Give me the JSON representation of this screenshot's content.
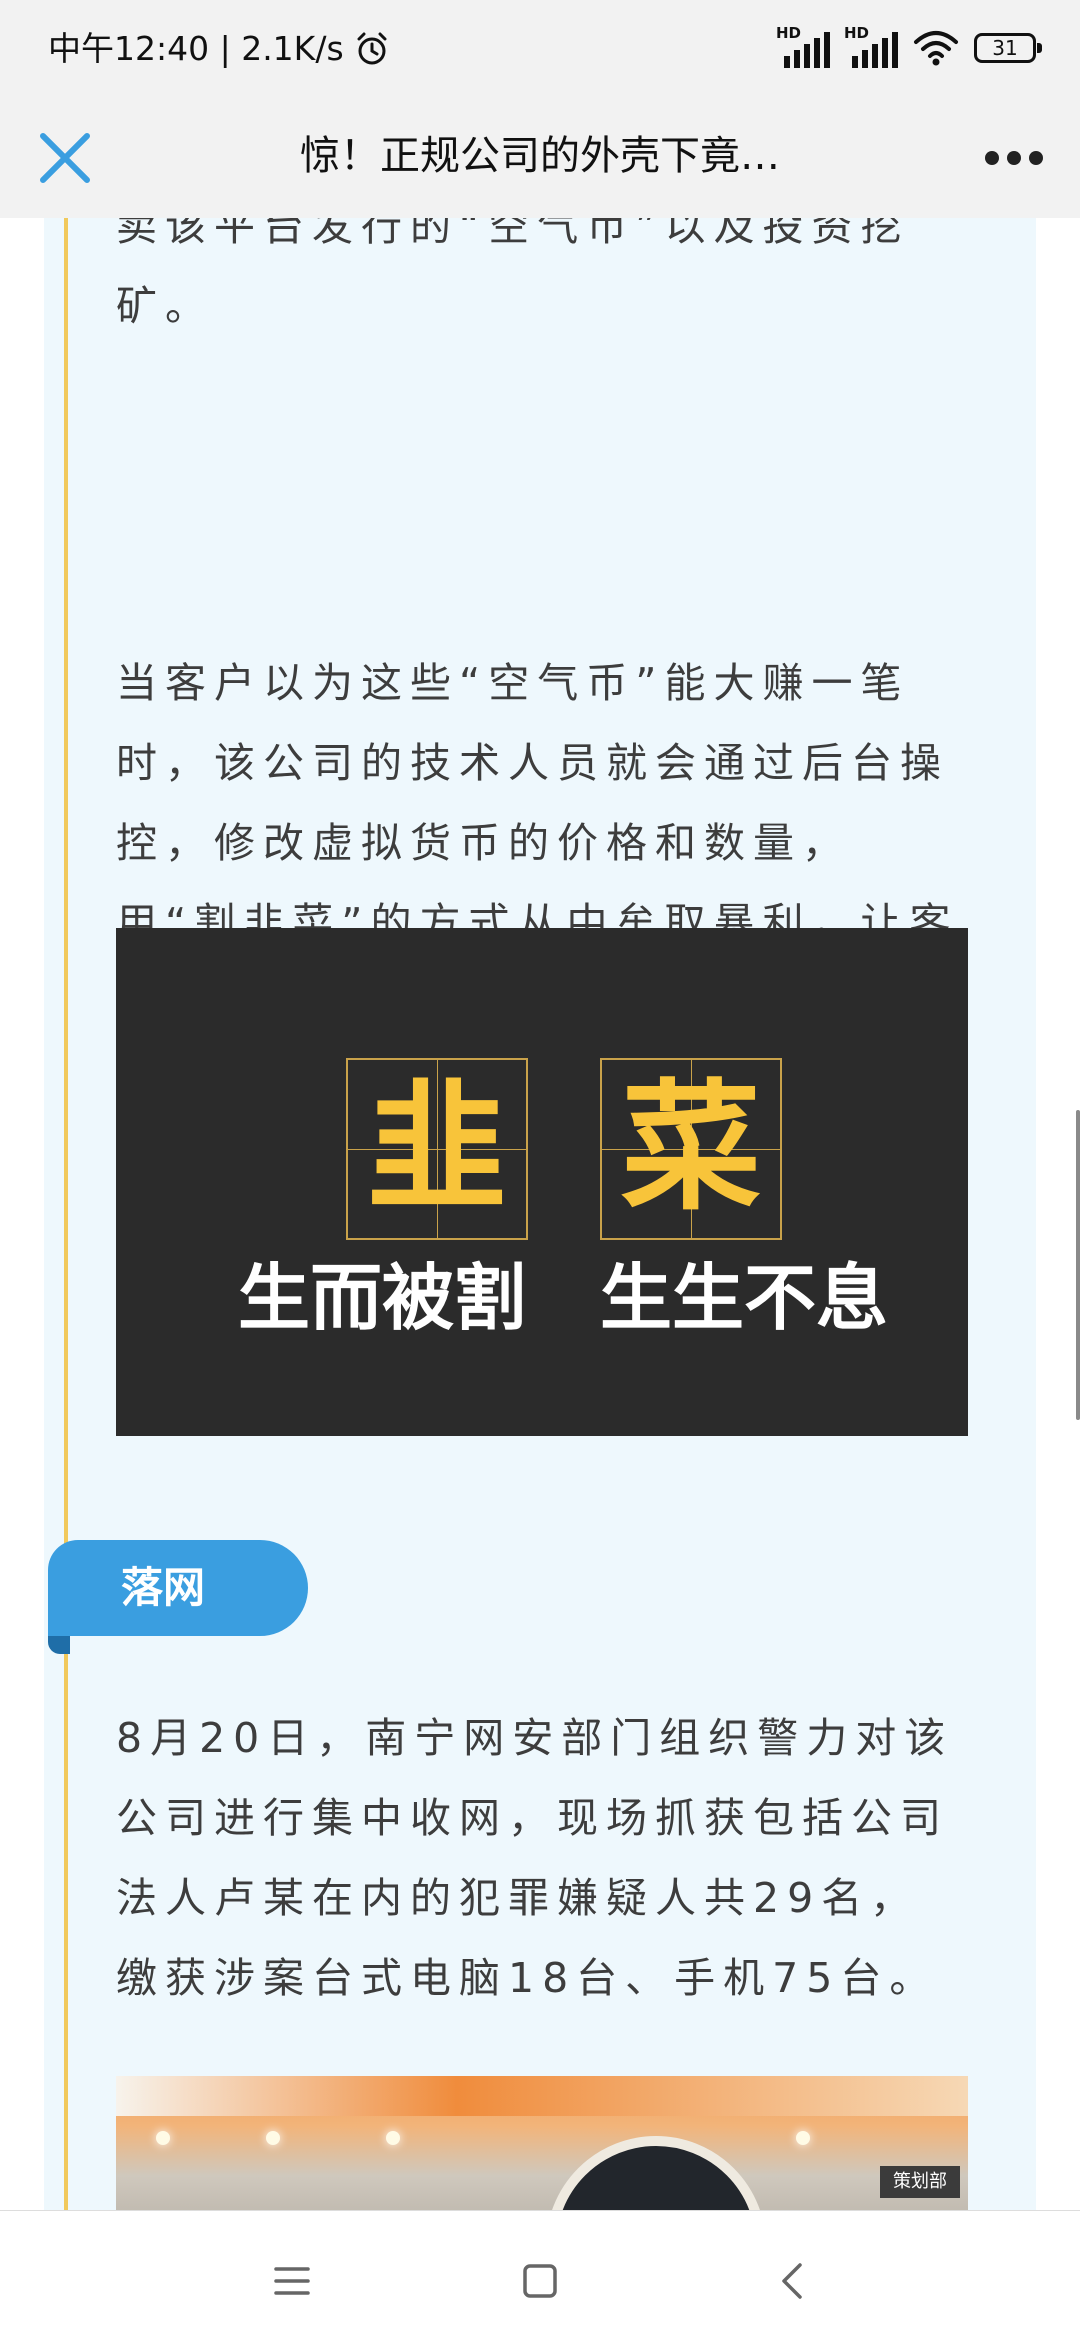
{
  "status_bar": {
    "time_network": "中午12:40 | 2.1K/s",
    "hd1": "HD",
    "hd2": "HD",
    "battery": "31"
  },
  "header": {
    "title": "惊！正规公司的外壳下竟…",
    "close_icon": "close-icon",
    "more_icon": "more-dots-icon",
    "accent_color": "#3a9ee0"
  },
  "article": {
    "para1": "卖该平台发行的“空气币”以及投资挖矿。",
    "para2": "当客户以为这些“空气币”能大赚一笔时，该公司的技术人员就会通过后台操控，修改虚拟货币的价格和数量，用“割韭菜”的方式从中牟取暴利，让客户血本无归！",
    "image1": {
      "char1": "韭",
      "char2": "菜",
      "slogan1": "生而被割",
      "slogan2": "生生不息"
    },
    "section_tag": "落网",
    "para3": "8月20日，南宁网安部门组织警力对该公司进行集中收网，现场抓获包括公司法人卢某在内的犯罪嫌疑人共29名，缴获涉案台式电脑18台、手机75台。",
    "image2": {
      "sign_text": "策划部"
    }
  },
  "nav_bar": {
    "menu_icon": "menu-icon",
    "home_icon": "home-icon",
    "back_icon": "back-icon"
  }
}
